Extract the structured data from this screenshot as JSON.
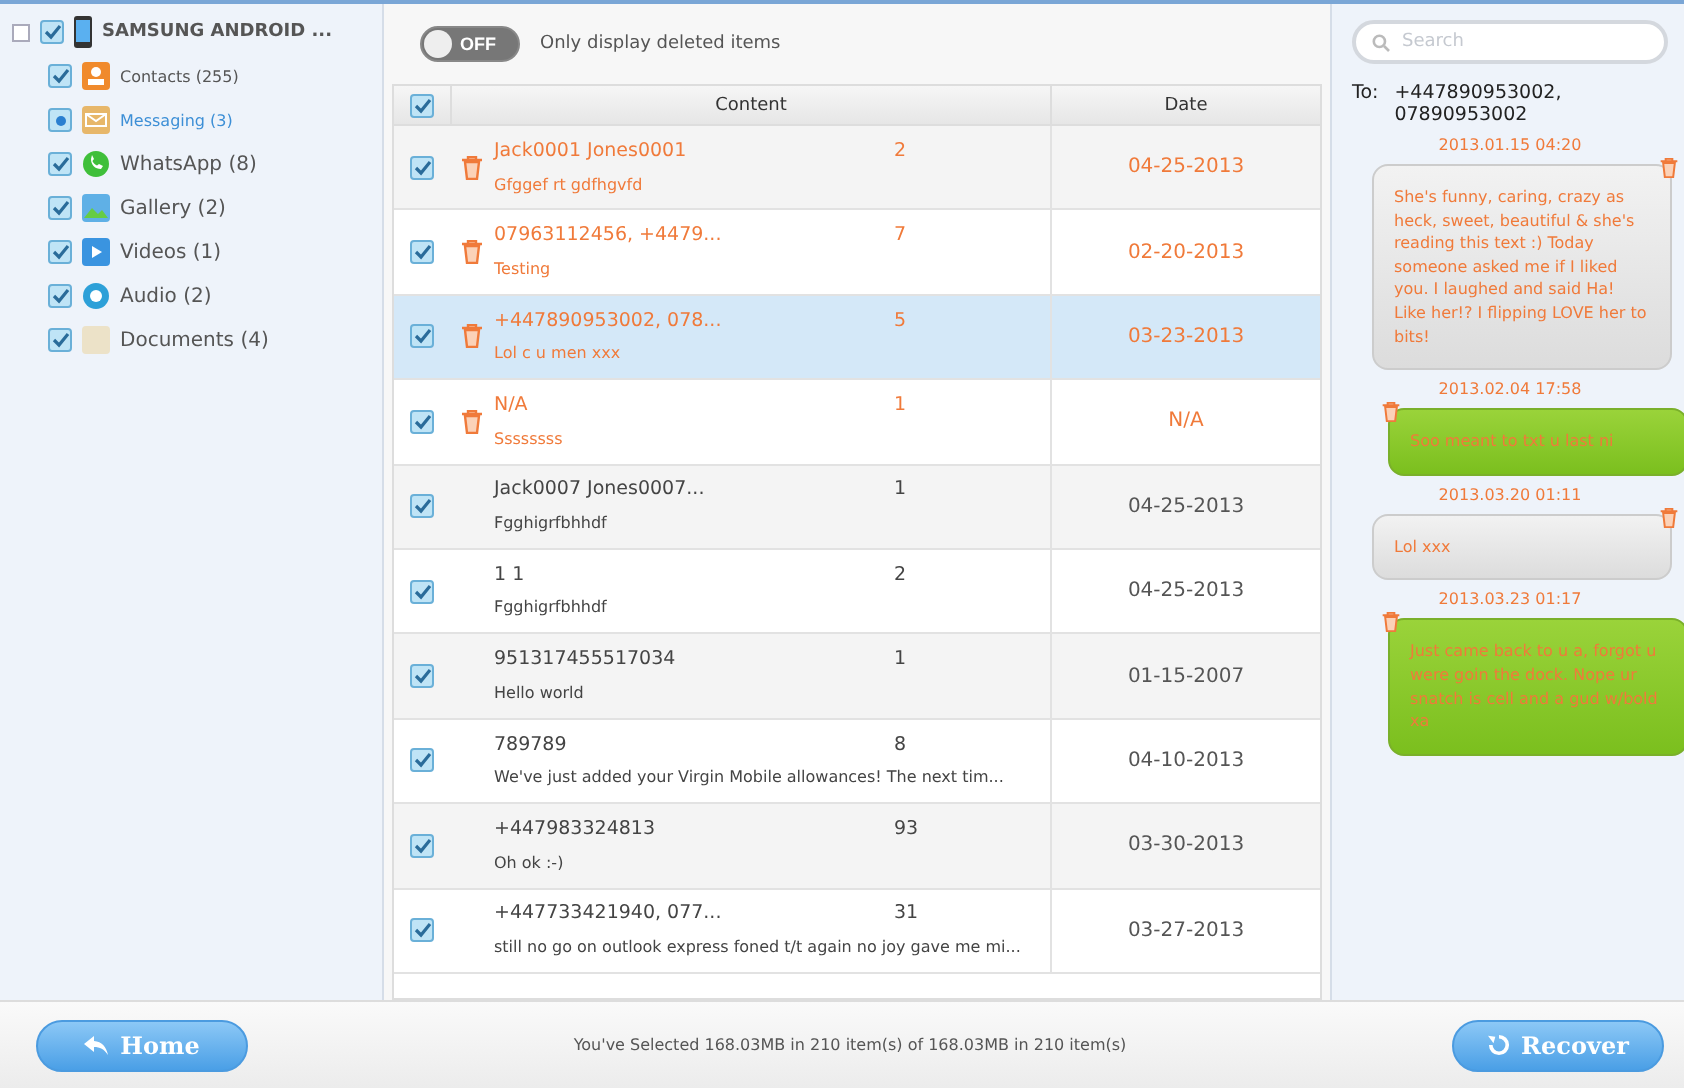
{
  "sidebar": {
    "device": {
      "label": "SAMSUNG ANDROID ...",
      "checked": true
    },
    "items": [
      {
        "label": "Contacts (255)",
        "checked": true,
        "partial": false,
        "selected": false
      },
      {
        "label": "Messaging (3)",
        "checked": true,
        "partial": true,
        "selected": true
      },
      {
        "label": "WhatsApp (8)",
        "checked": true,
        "partial": false,
        "selected": false
      },
      {
        "label": "Gallery (2)",
        "checked": true,
        "partial": false,
        "selected": false
      },
      {
        "label": "Videos (1)",
        "checked": true,
        "partial": false,
        "selected": false
      },
      {
        "label": "Audio (2)",
        "checked": true,
        "partial": false,
        "selected": false
      },
      {
        "label": "Documents (4)",
        "checked": true,
        "partial": false,
        "selected": false
      }
    ]
  },
  "toggle": {
    "label": "OFF",
    "on": false,
    "caption": "Only display deleted items"
  },
  "table": {
    "all_checked": true,
    "columns": [
      "Content",
      "Date"
    ],
    "rows": [
      {
        "checked": true,
        "deleted": true,
        "selected": false,
        "contact": "Jack0001  Jones0001",
        "count": "2",
        "message": "Gfggef rt gdfhgvfd",
        "date": "04-25-2013"
      },
      {
        "checked": true,
        "deleted": true,
        "selected": false,
        "contact": "07963112456, +4479...",
        "count": "7",
        "message": "Testing",
        "date": "02-20-2013"
      },
      {
        "checked": true,
        "deleted": true,
        "selected": true,
        "contact": "+447890953002, 078...",
        "count": "5",
        "message": "Lol c u men xxx",
        "date": "03-23-2013"
      },
      {
        "checked": true,
        "deleted": true,
        "selected": false,
        "contact": "N/A",
        "count": "1",
        "message": "Ssssssss",
        "date": "N/A"
      },
      {
        "checked": true,
        "deleted": false,
        "selected": false,
        "contact": "Jack0007  Jones0007...",
        "count": "1",
        "message": "Fgghigrfbhhdf",
        "date": "04-25-2013"
      },
      {
        "checked": true,
        "deleted": false,
        "selected": false,
        "contact": "1 1",
        "count": "2",
        "message": "Fgghigrfbhhdf",
        "date": "04-25-2013"
      },
      {
        "checked": true,
        "deleted": false,
        "selected": false,
        "contact": "951317455517034",
        "count": "1",
        "message": "Hello world",
        "date": "01-15-2007"
      },
      {
        "checked": true,
        "deleted": false,
        "selected": false,
        "contact": "789789",
        "count": "8",
        "message": "We've just added your Virgin Mobile allowances! The next tim...",
        "date": "04-10-2013"
      },
      {
        "checked": true,
        "deleted": false,
        "selected": false,
        "contact": "+447983324813",
        "count": "93",
        "message": "Oh ok :-)",
        "date": "03-30-2013"
      },
      {
        "checked": true,
        "deleted": false,
        "selected": false,
        "contact": "+447733421940, 077...",
        "count": "31",
        "message": "still no go on outlook express foned t/t again no joy gave me mi...",
        "date": "03-27-2013"
      }
    ]
  },
  "conversation": {
    "search_placeholder": "Search",
    "to_label": "To:",
    "to": "+447890953002, 07890953002",
    "messages": [
      {
        "time": "2013.01.15 04:20",
        "kind": "received",
        "deleted": true,
        "text": "She's funny, caring, crazy as heck, sweet, beautiful & she's reading this text :) Today someone asked me if I liked you. I laughed and said Ha! Like her!? I flipping LOVE her to bits!"
      },
      {
        "time": "2013.02.04 17:58",
        "kind": "sent",
        "deleted": true,
        "text": "Soo meant to txt u last ni"
      },
      {
        "time": "2013.03.20 01:11",
        "kind": "received",
        "deleted": true,
        "text": "Lol xxx"
      },
      {
        "time": "2013.03.23 01:17",
        "kind": "sent",
        "deleted": true,
        "text": "Just came back to u a, forgot u were goin the dock. Nope ur snatch is cell and a gud w/bold xa"
      }
    ]
  },
  "footer": {
    "home": "Home",
    "status": "You've Selected 168.03MB in 210 item(s) of 168.03MB in 210 item(s)",
    "recover": "Recover"
  }
}
